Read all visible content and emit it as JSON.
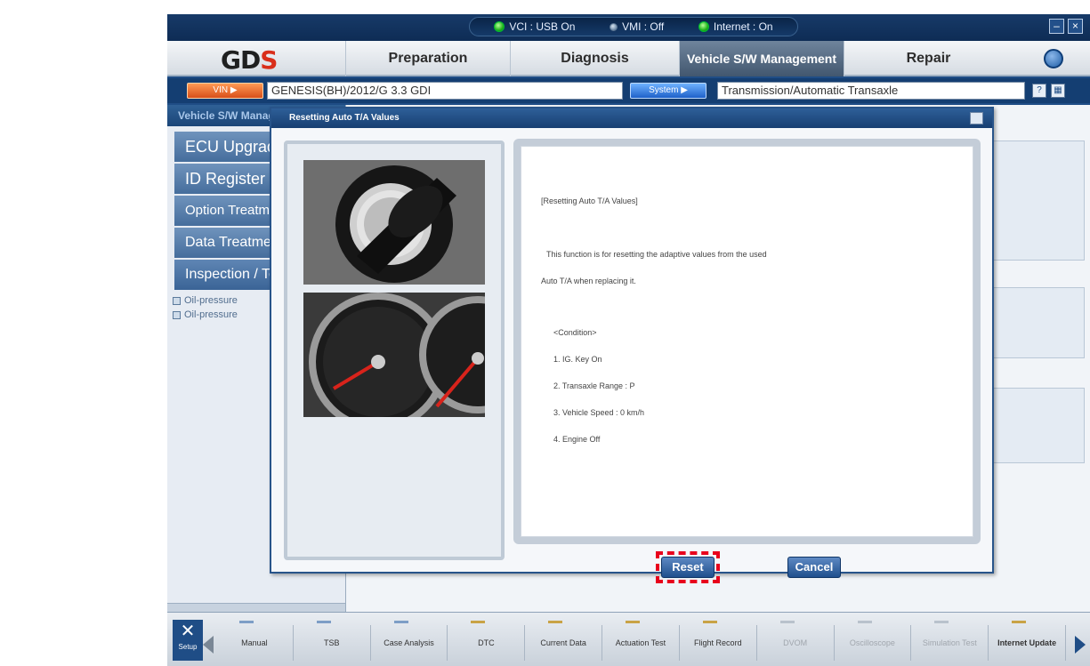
{
  "status": {
    "vci": "VCI : USB On",
    "vmi": "VMI : Off",
    "internet": "Internet : On"
  },
  "window_controls": {
    "minimize": "–",
    "close": "×"
  },
  "menu": {
    "logo_main": "GD",
    "logo_accent": "S",
    "tabs": [
      "Preparation",
      "Diagnosis",
      "Vehicle S/W Management",
      "Repair"
    ],
    "active_tab": "Vehicle S/W Management"
  },
  "vehicle_bar": {
    "vin_button": "VIN",
    "vehicle": "GENESIS(BH)/2012/G 3.3 GDI",
    "system_button": "System",
    "system": "Transmission/Automatic Transaxle"
  },
  "left_panel": {
    "title": "Vehicle S/W Management",
    "items": [
      "ECU Upgrade",
      "ID Register",
      "Option Treatment",
      "Data Treatment",
      "Inspection / Test"
    ],
    "sub_items": [
      "Oil-pressure",
      "Oil-pressure"
    ]
  },
  "dialog": {
    "title": "Resetting Auto T/A Values",
    "text": {
      "heading": "[Resetting Auto T/A Values]",
      "line1": "This function is for resetting the adaptive values from the used",
      "line2": "Auto T/A when replacing it.",
      "condition_heading": "<Condition>",
      "conditions": [
        "1. IG. Key On",
        "2. Transaxle Range : P",
        "3. Vehicle Speed : 0 km/h",
        "4. Engine Off"
      ]
    },
    "reset_button": "Reset",
    "cancel_button": "Cancel"
  },
  "toolbar": {
    "setup": "Setup",
    "items": [
      "Manual",
      "TSB",
      "Case Analysis",
      "DTC",
      "Current Data",
      "Actuation Test",
      "Flight Record",
      "DVOM",
      "Oscilloscope",
      "Simulation Test",
      "Internet Update"
    ]
  },
  "colors": {
    "accent": "#1f4d86",
    "status_on": "#23b51b",
    "highlight": "#e8001c",
    "logo_red": "#d92f1b"
  }
}
